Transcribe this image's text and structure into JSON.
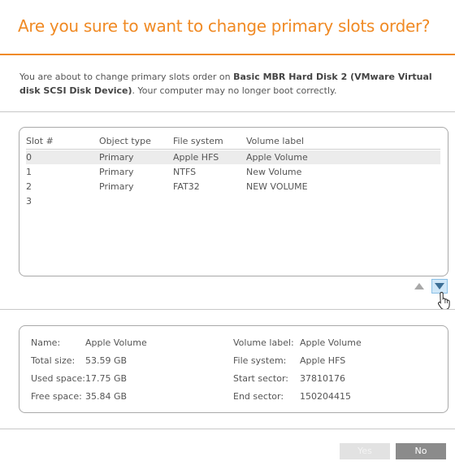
{
  "dialog": {
    "title": "Are you sure to want to change primary slots order?",
    "message_prefix": "You are about to change primary slots order on ",
    "message_disk": "Basic MBR Hard Disk 2 (VMware Virtual disk SCSI Disk Device)",
    "message_suffix": ". Your computer may no longer boot correctly."
  },
  "table": {
    "columns": [
      "Slot #",
      "Object type",
      "File system",
      "Volume label"
    ],
    "rows": [
      {
        "slot": "0",
        "type": "Primary",
        "fs": "Apple HFS",
        "label": "Apple Volume",
        "selected": true
      },
      {
        "slot": "1",
        "type": "Primary",
        "fs": "NTFS",
        "label": "New Volume",
        "selected": false
      },
      {
        "slot": "2",
        "type": "Primary",
        "fs": "FAT32",
        "label": "NEW VOLUME",
        "selected": false
      },
      {
        "slot": "3",
        "type": "",
        "fs": "",
        "label": "",
        "selected": false
      }
    ]
  },
  "details": {
    "name_label": "Name:",
    "name_value": "Apple Volume",
    "total_label": "Total size:",
    "total_value": "53.59 GB",
    "used_label": "Used space:",
    "used_value": "17.75 GB",
    "free_label": "Free space:",
    "free_value": "35.84 GB",
    "vlabel_label": "Volume label:",
    "vlabel_value": "Apple Volume",
    "fs_label": "File system:",
    "fs_value": "Apple HFS",
    "start_label": "Start sector:",
    "start_value": "37810176",
    "end_label": "End sector:",
    "end_value": "150204415"
  },
  "buttons": {
    "yes": "Yes",
    "no": "No"
  },
  "icons": {
    "move_up": "arrow-up-icon",
    "move_down": "arrow-down-icon",
    "cursor": "hand-pointer-icon"
  },
  "colors": {
    "accent": "#f08a24",
    "selected_row": "#ececec",
    "no_button": "#8b8b8b"
  }
}
